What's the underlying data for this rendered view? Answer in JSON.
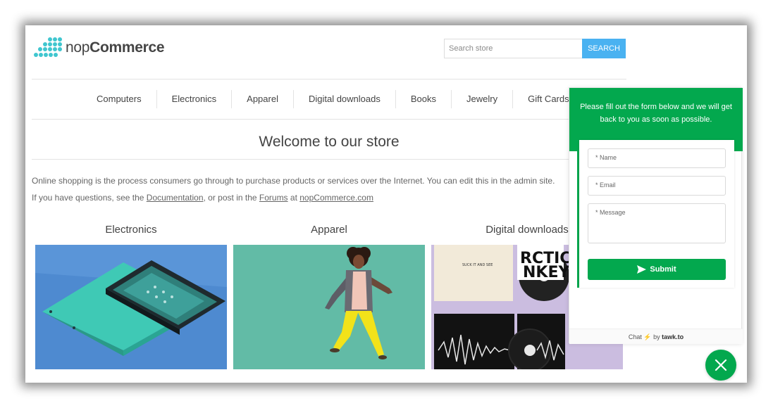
{
  "header": {
    "logo_text_prefix": "nop",
    "logo_text_suffix": "Commerce",
    "search_placeholder": "Search store",
    "search_button_label": "SEARCH"
  },
  "nav": {
    "items": [
      {
        "label": "Computers"
      },
      {
        "label": "Electronics"
      },
      {
        "label": "Apparel"
      },
      {
        "label": "Digital downloads"
      },
      {
        "label": "Books"
      },
      {
        "label": "Jewelry"
      },
      {
        "label": "Gift Cards"
      }
    ]
  },
  "main": {
    "welcome_title": "Welcome to our store",
    "intro_line1": "Online shopping is the process consumers go through to purchase products or services over the Internet. You can edit this in the admin site.",
    "intro_line2_a": "If you have questions, see the ",
    "intro_link_documentation": "Documentation",
    "intro_line2_b": ", or post in the ",
    "intro_link_forums": "Forums",
    "intro_line2_c": " at ",
    "intro_link_site": "nopCommerce.com",
    "categories": [
      {
        "title": "Electronics",
        "image_icon": "phone-image"
      },
      {
        "title": "Apparel",
        "image_icon": "apparel-image"
      },
      {
        "title": "Digital downloads",
        "image_icon": "vinyl-records-image"
      }
    ],
    "album_art_text": {
      "first_album": "SUCK IT AND SEE",
      "second_album_line1": "RCTIC",
      "second_album_line2": "NKEYS"
    }
  },
  "chat": {
    "header_text": "Please fill out the form below and we will get back to you as soon as possible.",
    "name_placeholder": "* Name",
    "email_placeholder": "* Email",
    "message_placeholder": "* Message",
    "submit_label": "Submit",
    "footer_prefix": "Chat",
    "footer_by": "by",
    "footer_brand": "tawk.to"
  },
  "colors": {
    "accent_blue": "#4ab2f1",
    "chat_green": "#03a84e",
    "logo_dots": "#3fc6cf"
  }
}
